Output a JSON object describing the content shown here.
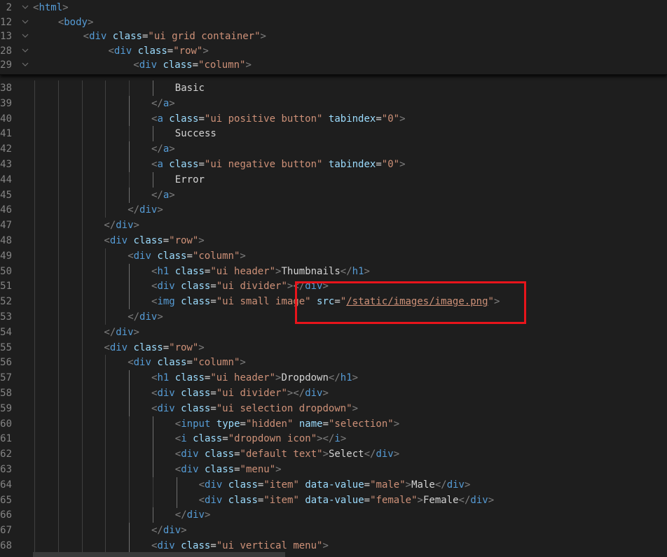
{
  "editor": {
    "sticky_lines": [
      {
        "number": "2",
        "indent": 0,
        "tokens": [
          [
            "br",
            "<"
          ],
          [
            "tag",
            "html"
          ],
          [
            "br",
            ">"
          ]
        ]
      },
      {
        "number": "12",
        "indent": 1,
        "tokens": [
          [
            "br",
            "<"
          ],
          [
            "tag",
            "body"
          ],
          [
            "br",
            ">"
          ]
        ]
      },
      {
        "number": "13",
        "indent": 2,
        "tokens": [
          [
            "br",
            "<"
          ],
          [
            "tag",
            "div "
          ],
          [
            "attr",
            "class"
          ],
          [
            "txt",
            "="
          ],
          [
            "str",
            "\"ui grid container\""
          ],
          [
            "br",
            ">"
          ]
        ]
      },
      {
        "number": "28",
        "indent": 3,
        "tokens": [
          [
            "br",
            "<"
          ],
          [
            "tag",
            "div "
          ],
          [
            "attr",
            "class"
          ],
          [
            "txt",
            "="
          ],
          [
            "str",
            "\"row\""
          ],
          [
            "br",
            ">"
          ]
        ]
      },
      {
        "number": "29",
        "indent": 4,
        "tokens": [
          [
            "br",
            "<"
          ],
          [
            "tag",
            "div "
          ],
          [
            "attr",
            "class"
          ],
          [
            "txt",
            "="
          ],
          [
            "str",
            "\"column\""
          ],
          [
            "br",
            ">"
          ]
        ]
      }
    ],
    "lines": [
      {
        "number": "38",
        "indent": 6,
        "tokens": [
          [
            "txt",
            "Basic"
          ]
        ]
      },
      {
        "number": "39",
        "indent": 5,
        "tokens": [
          [
            "br",
            "</"
          ],
          [
            "tag",
            "a"
          ],
          [
            "br",
            ">"
          ]
        ]
      },
      {
        "number": "40",
        "indent": 5,
        "tokens": [
          [
            "br",
            "<"
          ],
          [
            "tag",
            "a "
          ],
          [
            "attr",
            "class"
          ],
          [
            "txt",
            "="
          ],
          [
            "str",
            "\"ui positive button\""
          ],
          [
            "txt",
            " "
          ],
          [
            "attr",
            "tabindex"
          ],
          [
            "txt",
            "="
          ],
          [
            "str",
            "\"0\""
          ],
          [
            "br",
            ">"
          ]
        ]
      },
      {
        "number": "41",
        "indent": 6,
        "tokens": [
          [
            "txt",
            "Success"
          ]
        ]
      },
      {
        "number": "42",
        "indent": 5,
        "tokens": [
          [
            "br",
            "</"
          ],
          [
            "tag",
            "a"
          ],
          [
            "br",
            ">"
          ]
        ]
      },
      {
        "number": "43",
        "indent": 5,
        "tokens": [
          [
            "br",
            "<"
          ],
          [
            "tag",
            "a "
          ],
          [
            "attr",
            "class"
          ],
          [
            "txt",
            "="
          ],
          [
            "str",
            "\"ui negative button\""
          ],
          [
            "txt",
            " "
          ],
          [
            "attr",
            "tabindex"
          ],
          [
            "txt",
            "="
          ],
          [
            "str",
            "\"0\""
          ],
          [
            "br",
            ">"
          ]
        ]
      },
      {
        "number": "44",
        "indent": 6,
        "tokens": [
          [
            "txt",
            "Error"
          ]
        ]
      },
      {
        "number": "45",
        "indent": 5,
        "tokens": [
          [
            "br",
            "</"
          ],
          [
            "tag",
            "a"
          ],
          [
            "br",
            ">"
          ]
        ]
      },
      {
        "number": "46",
        "indent": 4,
        "tokens": [
          [
            "br",
            "</"
          ],
          [
            "tag",
            "div"
          ],
          [
            "br",
            ">"
          ]
        ]
      },
      {
        "number": "47",
        "indent": 3,
        "tokens": [
          [
            "br",
            "</"
          ],
          [
            "tag",
            "div"
          ],
          [
            "br",
            ">"
          ]
        ]
      },
      {
        "number": "48",
        "indent": 3,
        "tokens": [
          [
            "br",
            "<"
          ],
          [
            "tag",
            "div "
          ],
          [
            "attr",
            "class"
          ],
          [
            "txt",
            "="
          ],
          [
            "str",
            "\"row\""
          ],
          [
            "br",
            ">"
          ]
        ]
      },
      {
        "number": "49",
        "indent": 4,
        "tokens": [
          [
            "br",
            "<"
          ],
          [
            "tag",
            "div "
          ],
          [
            "attr",
            "class"
          ],
          [
            "txt",
            "="
          ],
          [
            "str",
            "\"column\""
          ],
          [
            "br",
            ">"
          ]
        ]
      },
      {
        "number": "50",
        "indent": 5,
        "tokens": [
          [
            "br",
            "<"
          ],
          [
            "tag",
            "h1 "
          ],
          [
            "attr",
            "class"
          ],
          [
            "txt",
            "="
          ],
          [
            "str",
            "\"ui header\""
          ],
          [
            "br",
            ">"
          ],
          [
            "txt",
            "Thumbnails"
          ],
          [
            "br",
            "</"
          ],
          [
            "tag",
            "h1"
          ],
          [
            "br",
            ">"
          ]
        ]
      },
      {
        "number": "51",
        "indent": 5,
        "tokens": [
          [
            "br",
            "<"
          ],
          [
            "tag",
            "div "
          ],
          [
            "attr",
            "class"
          ],
          [
            "txt",
            "="
          ],
          [
            "str",
            "\"ui divider\""
          ],
          [
            "br",
            "></"
          ],
          [
            "tag",
            "div"
          ],
          [
            "br",
            ">"
          ]
        ]
      },
      {
        "number": "52",
        "indent": 5,
        "tokens": [
          [
            "br",
            "<"
          ],
          [
            "tag",
            "img "
          ],
          [
            "attr",
            "class"
          ],
          [
            "txt",
            "="
          ],
          [
            "str",
            "\"ui small image\""
          ],
          [
            "txt",
            " "
          ],
          [
            "attr",
            "src"
          ],
          [
            "txt",
            "="
          ],
          [
            "str",
            "\""
          ],
          [
            "link",
            "/static/images/image.png"
          ],
          [
            "str",
            "\""
          ],
          [
            "br",
            ">"
          ]
        ]
      },
      {
        "number": "53",
        "indent": 4,
        "tokens": [
          [
            "br",
            "</"
          ],
          [
            "tag",
            "div"
          ],
          [
            "br",
            ">"
          ]
        ]
      },
      {
        "number": "54",
        "indent": 3,
        "tokens": [
          [
            "br",
            "</"
          ],
          [
            "tag",
            "div"
          ],
          [
            "br",
            ">"
          ]
        ]
      },
      {
        "number": "55",
        "indent": 3,
        "tokens": [
          [
            "br",
            "<"
          ],
          [
            "tag",
            "div "
          ],
          [
            "attr",
            "class"
          ],
          [
            "txt",
            "="
          ],
          [
            "str",
            "\"row\""
          ],
          [
            "br",
            ">"
          ]
        ]
      },
      {
        "number": "56",
        "indent": 4,
        "tokens": [
          [
            "br",
            "<"
          ],
          [
            "tag",
            "div "
          ],
          [
            "attr",
            "class"
          ],
          [
            "txt",
            "="
          ],
          [
            "str",
            "\"column\""
          ],
          [
            "br",
            ">"
          ]
        ]
      },
      {
        "number": "57",
        "indent": 5,
        "tokens": [
          [
            "br",
            "<"
          ],
          [
            "tag",
            "h1 "
          ],
          [
            "attr",
            "class"
          ],
          [
            "txt",
            "="
          ],
          [
            "str",
            "\"ui header\""
          ],
          [
            "br",
            ">"
          ],
          [
            "txt",
            "Dropdown"
          ],
          [
            "br",
            "</"
          ],
          [
            "tag",
            "h1"
          ],
          [
            "br",
            ">"
          ]
        ]
      },
      {
        "number": "58",
        "indent": 5,
        "tokens": [
          [
            "br",
            "<"
          ],
          [
            "tag",
            "div "
          ],
          [
            "attr",
            "class"
          ],
          [
            "txt",
            "="
          ],
          [
            "str",
            "\"ui divider\""
          ],
          [
            "br",
            "></"
          ],
          [
            "tag",
            "div"
          ],
          [
            "br",
            ">"
          ]
        ]
      },
      {
        "number": "59",
        "indent": 5,
        "tokens": [
          [
            "br",
            "<"
          ],
          [
            "tag",
            "div "
          ],
          [
            "attr",
            "class"
          ],
          [
            "txt",
            "="
          ],
          [
            "str",
            "\"ui selection dropdown\""
          ],
          [
            "br",
            ">"
          ]
        ]
      },
      {
        "number": "60",
        "indent": 6,
        "tokens": [
          [
            "br",
            "<"
          ],
          [
            "tag",
            "input "
          ],
          [
            "attr",
            "type"
          ],
          [
            "txt",
            "="
          ],
          [
            "str",
            "\"hidden\""
          ],
          [
            "txt",
            " "
          ],
          [
            "attr",
            "name"
          ],
          [
            "txt",
            "="
          ],
          [
            "str",
            "\"selection\""
          ],
          [
            "br",
            ">"
          ]
        ]
      },
      {
        "number": "61",
        "indent": 6,
        "tokens": [
          [
            "br",
            "<"
          ],
          [
            "tag",
            "i "
          ],
          [
            "attr",
            "class"
          ],
          [
            "txt",
            "="
          ],
          [
            "str",
            "\"dropdown icon\""
          ],
          [
            "br",
            "></"
          ],
          [
            "tag",
            "i"
          ],
          [
            "br",
            ">"
          ]
        ]
      },
      {
        "number": "62",
        "indent": 6,
        "tokens": [
          [
            "br",
            "<"
          ],
          [
            "tag",
            "div "
          ],
          [
            "attr",
            "class"
          ],
          [
            "txt",
            "="
          ],
          [
            "str",
            "\"default text\""
          ],
          [
            "br",
            ">"
          ],
          [
            "txt",
            "Select"
          ],
          [
            "br",
            "</"
          ],
          [
            "tag",
            "div"
          ],
          [
            "br",
            ">"
          ]
        ]
      },
      {
        "number": "63",
        "indent": 6,
        "tokens": [
          [
            "br",
            "<"
          ],
          [
            "tag",
            "div "
          ],
          [
            "attr",
            "class"
          ],
          [
            "txt",
            "="
          ],
          [
            "str",
            "\"menu\""
          ],
          [
            "br",
            ">"
          ]
        ]
      },
      {
        "number": "64",
        "indent": 7,
        "tokens": [
          [
            "br",
            "<"
          ],
          [
            "tag",
            "div "
          ],
          [
            "attr",
            "class"
          ],
          [
            "txt",
            "="
          ],
          [
            "str",
            "\"item\""
          ],
          [
            "txt",
            " "
          ],
          [
            "attr",
            "data-value"
          ],
          [
            "txt",
            "="
          ],
          [
            "str",
            "\"male\""
          ],
          [
            "br",
            ">"
          ],
          [
            "txt",
            "Male"
          ],
          [
            "br",
            "</"
          ],
          [
            "tag",
            "div"
          ],
          [
            "br",
            ">"
          ]
        ]
      },
      {
        "number": "65",
        "indent": 7,
        "tokens": [
          [
            "br",
            "<"
          ],
          [
            "tag",
            "div "
          ],
          [
            "attr",
            "class"
          ],
          [
            "txt",
            "="
          ],
          [
            "str",
            "\"item\""
          ],
          [
            "txt",
            " "
          ],
          [
            "attr",
            "data-value"
          ],
          [
            "txt",
            "="
          ],
          [
            "str",
            "\"female\""
          ],
          [
            "br",
            ">"
          ],
          [
            "txt",
            "Female"
          ],
          [
            "br",
            "</"
          ],
          [
            "tag",
            "div"
          ],
          [
            "br",
            ">"
          ]
        ]
      },
      {
        "number": "66",
        "indent": 6,
        "tokens": [
          [
            "br",
            "</"
          ],
          [
            "tag",
            "div"
          ],
          [
            "br",
            ">"
          ]
        ]
      },
      {
        "number": "67",
        "indent": 5,
        "tokens": [
          [
            "br",
            "</"
          ],
          [
            "tag",
            "div"
          ],
          [
            "br",
            ">"
          ]
        ]
      },
      {
        "number": "68",
        "indent": 5,
        "tokens": [
          [
            "br",
            "<"
          ],
          [
            "tag",
            "div "
          ],
          [
            "attr",
            "class"
          ],
          [
            "txt",
            "="
          ],
          [
            "str",
            "\"ui vertical menu\""
          ],
          [
            "br",
            ">"
          ]
        ]
      }
    ],
    "fold_icon": "chevron-down-icon",
    "colors": {
      "background": "#1e1e1e",
      "tag": "#569cd6",
      "attribute": "#9cdcfe",
      "string": "#ce9178",
      "text": "#d4d4d4",
      "line_number": "#858585",
      "highlight_box": "#e8141b"
    }
  }
}
